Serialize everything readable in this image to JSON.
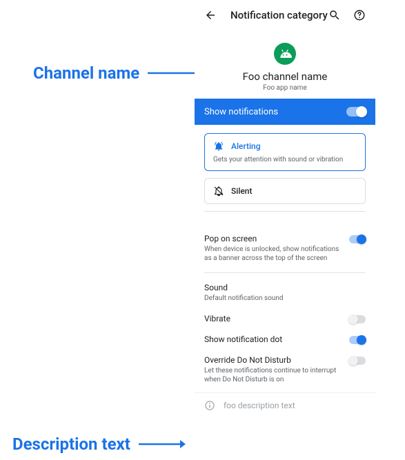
{
  "annotations": {
    "channel_name": "Channel name",
    "description_text": "Description text"
  },
  "header": {
    "title": "Notification category"
  },
  "channel": {
    "name": "Foo channel name",
    "app_name": "Foo app name"
  },
  "show_notifications": {
    "label": "Show notifications",
    "enabled": true
  },
  "behavior_options": {
    "alerting": {
      "label": "Alerting",
      "sub": "Gets your attention with sound or vibration",
      "selected": true
    },
    "silent": {
      "label": "Silent",
      "selected": false
    }
  },
  "settings": {
    "pop_on_screen": {
      "title": "Pop on screen",
      "sub": "When device is unlocked, show notifications as a banner across the top of the screen",
      "enabled": true
    },
    "sound": {
      "title": "Sound",
      "sub": "Default notification sound"
    },
    "vibrate": {
      "title": "Vibrate",
      "enabled": false
    },
    "show_dot": {
      "title": "Show notification dot",
      "enabled": true
    },
    "override_dnd": {
      "title": "Override Do Not Disturb",
      "sub": "Let these notifications continue to interrupt when Do Not Disturb is on",
      "enabled": false
    }
  },
  "description": {
    "text": "foo description text"
  }
}
